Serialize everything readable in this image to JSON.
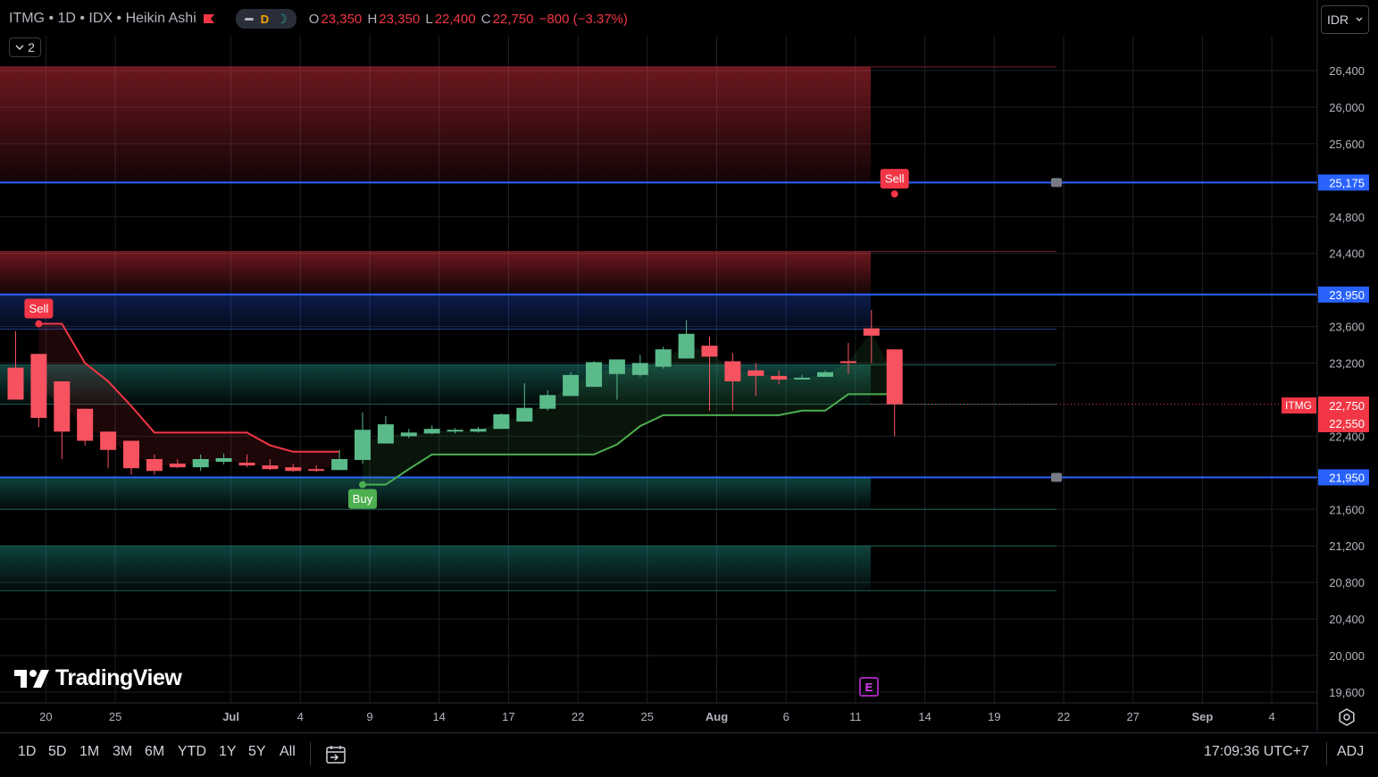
{
  "legend": {
    "symbol": "ITMG",
    "interval": "1D",
    "exchange": "IDX",
    "chart_style": "Heikin Ashi",
    "title": "ITMG • 1D • IDX • Heikin Ashi",
    "pill_d": "D",
    "o_label": "O",
    "o_value": "23,350",
    "h_label": "H",
    "h_value": "23,350",
    "l_label": "L",
    "l_value": "22,400",
    "c_label": "C",
    "c_value": "22,750",
    "change": "−800 (−3.37%)",
    "indicators_count": "2"
  },
  "currency": "IDR",
  "logo_text": "TradingView",
  "earnings_label": "E",
  "bottom_bar": {
    "ranges": [
      "1D",
      "5D",
      "1M",
      "3M",
      "6M",
      "YTD",
      "1Y",
      "5Y",
      "All"
    ],
    "clock": "17:09:36 UTC+7",
    "adj": "ADJ"
  },
  "colors": {
    "background": "#000000",
    "up": "#26a69a",
    "up_body": "#5aba8a",
    "down": "#f23645",
    "down_body": "#f7525f",
    "level_line": "#2962ff",
    "supertrend_up": "#4caf50",
    "supertrend_down": "#f23645"
  },
  "chart_data": {
    "type": "candlestick",
    "style": "Heikin Ashi",
    "ylim": [
      19400,
      26800
    ],
    "y_ticks": [
      "26,400",
      "26,000",
      "25,600",
      "24,800",
      "24,400",
      "23,600",
      "23,200",
      "22,400",
      "21,600",
      "21,200",
      "20,800",
      "20,400",
      "20,000",
      "19,600"
    ],
    "y_tick_values": [
      26400,
      26000,
      25600,
      24800,
      24400,
      23600,
      23200,
      22400,
      21600,
      21200,
      20800,
      20400,
      20000,
      19600
    ],
    "x_ticks": [
      "20",
      "25",
      "Jul",
      "4",
      "9",
      "14",
      "17",
      "22",
      "25",
      "Aug",
      "6",
      "11",
      "14",
      "19",
      "22",
      "27",
      "Sep",
      "4"
    ],
    "x_tick_days": [
      1,
      4,
      9,
      12,
      15,
      18,
      21,
      24,
      27,
      30,
      33,
      36,
      39,
      42,
      45,
      48,
      51,
      54
    ],
    "candles": [
      {
        "d": 0,
        "o": 23150,
        "h": 23550,
        "l": 22800,
        "c": 22800
      },
      {
        "d": 1,
        "o": 23300,
        "h": 23300,
        "l": 22500,
        "c": 22600
      },
      {
        "d": 2,
        "o": 23000,
        "h": 23000,
        "l": 22150,
        "c": 22450
      },
      {
        "d": 3,
        "o": 22700,
        "h": 22700,
        "l": 22300,
        "c": 22350
      },
      {
        "d": 4,
        "o": 22450,
        "h": 22450,
        "l": 22050,
        "c": 22250
      },
      {
        "d": 5,
        "o": 22350,
        "h": 22350,
        "l": 21980,
        "c": 22050
      },
      {
        "d": 6,
        "o": 22150,
        "h": 22200,
        "l": 21980,
        "c": 22020
      },
      {
        "d": 7,
        "o": 22100,
        "h": 22150,
        "l": 22050,
        "c": 22060
      },
      {
        "d": 8,
        "o": 22060,
        "h": 22200,
        "l": 22020,
        "c": 22150
      },
      {
        "d": 9,
        "o": 22120,
        "h": 22210,
        "l": 22090,
        "c": 22160
      },
      {
        "d": 10,
        "o": 22110,
        "h": 22200,
        "l": 22060,
        "c": 22080
      },
      {
        "d": 11,
        "o": 22080,
        "h": 22150,
        "l": 22030,
        "c": 22040
      },
      {
        "d": 12,
        "o": 22060,
        "h": 22100,
        "l": 22010,
        "c": 22020
      },
      {
        "d": 13,
        "o": 22040,
        "h": 22080,
        "l": 22010,
        "c": 22030
      },
      {
        "d": 14,
        "o": 22030,
        "h": 22250,
        "l": 22030,
        "c": 22150
      },
      {
        "d": 15,
        "o": 22140,
        "h": 22660,
        "l": 22100,
        "c": 22470
      },
      {
        "d": 16,
        "o": 22320,
        "h": 22620,
        "l": 22320,
        "c": 22530
      },
      {
        "d": 17,
        "o": 22400,
        "h": 22480,
        "l": 22380,
        "c": 22440
      },
      {
        "d": 18,
        "o": 22430,
        "h": 22520,
        "l": 22420,
        "c": 22480
      },
      {
        "d": 19,
        "o": 22460,
        "h": 22490,
        "l": 22430,
        "c": 22470
      },
      {
        "d": 20,
        "o": 22450,
        "h": 22500,
        "l": 22440,
        "c": 22480
      },
      {
        "d": 21,
        "o": 22480,
        "h": 22650,
        "l": 22480,
        "c": 22640
      },
      {
        "d": 22,
        "o": 22560,
        "h": 22980,
        "l": 22560,
        "c": 22710
      },
      {
        "d": 23,
        "o": 22700,
        "h": 22900,
        "l": 22680,
        "c": 22850
      },
      {
        "d": 24,
        "o": 22840,
        "h": 23100,
        "l": 22840,
        "c": 23070
      },
      {
        "d": 25,
        "o": 22940,
        "h": 23220,
        "l": 22940,
        "c": 23210
      },
      {
        "d": 26,
        "o": 23080,
        "h": 23200,
        "l": 22800,
        "c": 23240
      },
      {
        "d": 27,
        "o": 23070,
        "h": 23290,
        "l": 23050,
        "c": 23200
      },
      {
        "d": 28,
        "o": 23160,
        "h": 23380,
        "l": 23140,
        "c": 23350
      },
      {
        "d": 29,
        "o": 23250,
        "h": 23670,
        "l": 23250,
        "c": 23520
      },
      {
        "d": 30,
        "o": 23390,
        "h": 23490,
        "l": 22680,
        "c": 23270
      },
      {
        "d": 31,
        "o": 23220,
        "h": 23310,
        "l": 22680,
        "c": 23000
      },
      {
        "d": 32,
        "o": 23120,
        "h": 23200,
        "l": 22840,
        "c": 23060
      },
      {
        "d": 33,
        "o": 23060,
        "h": 23120,
        "l": 22970,
        "c": 23020
      },
      {
        "d": 34,
        "o": 23030,
        "h": 23070,
        "l": 23020,
        "c": 23040
      },
      {
        "d": 35,
        "o": 23050,
        "h": 23120,
        "l": 23050,
        "c": 23100
      },
      {
        "d": 36,
        "o": 23220,
        "h": 23420,
        "l": 23080,
        "c": 23210
      },
      {
        "d": 37,
        "o": 23580,
        "h": 23780,
        "l": 23200,
        "c": 23500
      },
      {
        "d": 38,
        "o": 23350,
        "h": 23350,
        "l": 22400,
        "c": 22750
      }
    ],
    "supertrend_down": [
      {
        "d": 1,
        "v": 23630
      },
      {
        "d": 2,
        "v": 23630
      },
      {
        "d": 3,
        "v": 23200
      },
      {
        "d": 4,
        "v": 23000
      },
      {
        "d": 5,
        "v": 22730
      },
      {
        "d": 6,
        "v": 22440
      },
      {
        "d": 7,
        "v": 22440
      },
      {
        "d": 8,
        "v": 22440
      },
      {
        "d": 9,
        "v": 22440
      },
      {
        "d": 10,
        "v": 22440
      },
      {
        "d": 11,
        "v": 22300
      },
      {
        "d": 12,
        "v": 22230
      },
      {
        "d": 13,
        "v": 22230
      },
      {
        "d": 14,
        "v": 22230
      }
    ],
    "supertrend_up": [
      {
        "d": 15,
        "v": 21870
      },
      {
        "d": 16,
        "v": 21870
      },
      {
        "d": 17,
        "v": 22040
      },
      {
        "d": 18,
        "v": 22200
      },
      {
        "d": 19,
        "v": 22200
      },
      {
        "d": 20,
        "v": 22200
      },
      {
        "d": 21,
        "v": 22200
      },
      {
        "d": 22,
        "v": 22200
      },
      {
        "d": 23,
        "v": 22200
      },
      {
        "d": 24,
        "v": 22200
      },
      {
        "d": 25,
        "v": 22200
      },
      {
        "d": 26,
        "v": 22310
      },
      {
        "d": 27,
        "v": 22510
      },
      {
        "d": 28,
        "v": 22630
      },
      {
        "d": 29,
        "v": 22630
      },
      {
        "d": 30,
        "v": 22630
      },
      {
        "d": 31,
        "v": 22630
      },
      {
        "d": 32,
        "v": 22630
      },
      {
        "d": 33,
        "v": 22630
      },
      {
        "d": 34,
        "v": 22680
      },
      {
        "d": 35,
        "v": 22680
      },
      {
        "d": 36,
        "v": 22860
      },
      {
        "d": 37,
        "v": 22860
      },
      {
        "d": 38,
        "v": 22860
      }
    ],
    "zones": [
      {
        "from": 25175,
        "to": 26440,
        "kind": "supply"
      },
      {
        "from": 23950,
        "to": 24420,
        "kind": "supply"
      },
      {
        "from": 23570,
        "to": 23950,
        "kind": "blue"
      },
      {
        "from": 22750,
        "to": 23180,
        "kind": "demand"
      },
      {
        "from": 21950,
        "to": 21600,
        "kind": "demand"
      },
      {
        "from": 21200,
        "to": 20710,
        "kind": "demand"
      }
    ],
    "levels": [
      {
        "value": 25175,
        "label": "25,175"
      },
      {
        "value": 23950,
        "label": "23,950"
      },
      {
        "value": 21950,
        "label": "21,950"
      }
    ],
    "price_labels": [
      {
        "value": 22750,
        "label": "22,750",
        "tag": "ITMG"
      },
      {
        "value": 22550,
        "label": "22,550"
      }
    ],
    "signals": [
      {
        "d": 1,
        "value": 23630,
        "label": "Sell",
        "kind": "sell"
      },
      {
        "d": 15,
        "value": 21870,
        "label": "Buy",
        "kind": "buy"
      },
      {
        "d": 38,
        "value": 25050,
        "label": "Sell",
        "kind": "sell"
      }
    ]
  }
}
